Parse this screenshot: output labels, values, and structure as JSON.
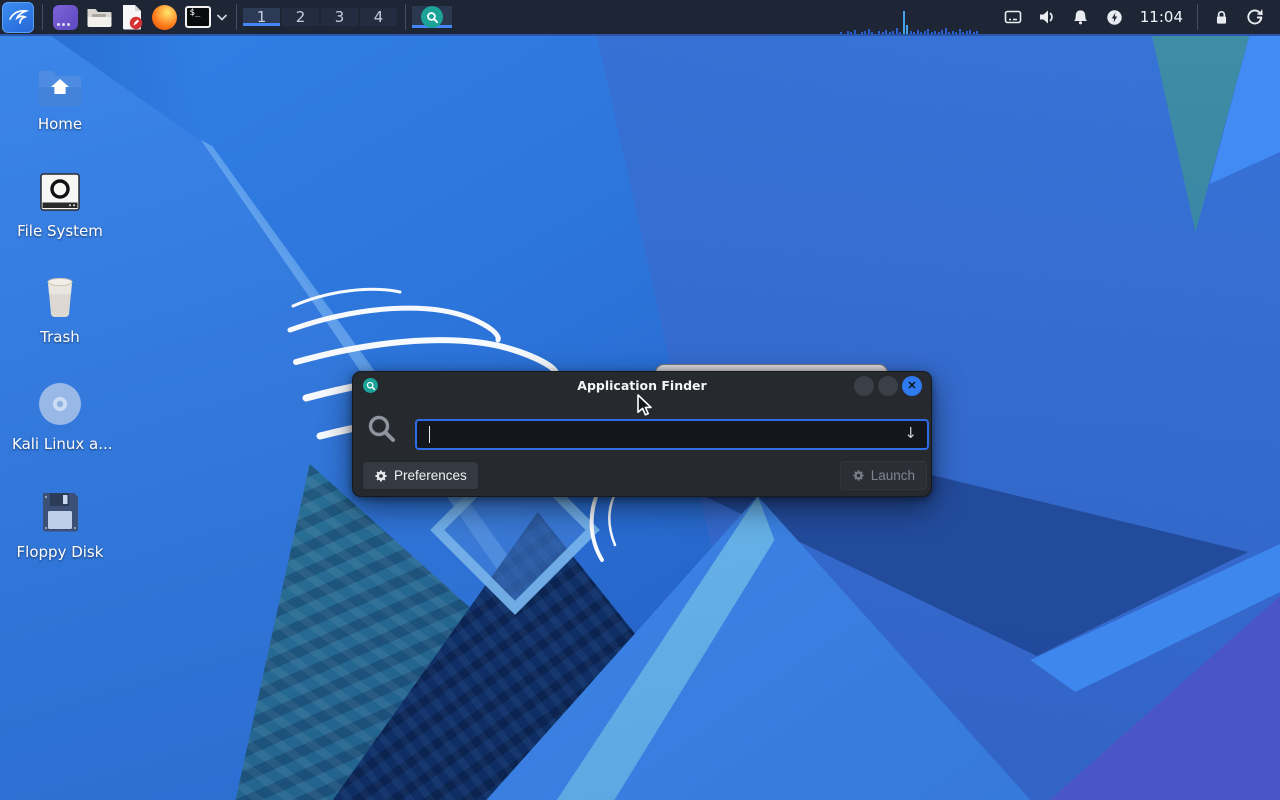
{
  "panel": {
    "clock": "11:04",
    "workspaces": [
      {
        "label": "1"
      },
      {
        "label": "2"
      },
      {
        "label": "3"
      },
      {
        "label": "4"
      }
    ],
    "active_workspace": 0,
    "terminal_prompt": "$_",
    "net_graph_bars": [
      2,
      0,
      3,
      2,
      4,
      0,
      2,
      3,
      5,
      2,
      0,
      3,
      2,
      4,
      2,
      3,
      6,
      2,
      23,
      9,
      3,
      2,
      4,
      2,
      3,
      5,
      2,
      3,
      2,
      4,
      6,
      2,
      3,
      2,
      5,
      2,
      3,
      4,
      2,
      3
    ],
    "colors": {
      "bar_blue": "#2a5fd0",
      "bar_cyan": "#45a3e8"
    }
  },
  "desktop": {
    "icons": [
      {
        "label": "Home"
      },
      {
        "label": "File System"
      },
      {
        "label": "Trash"
      },
      {
        "label": "Kali Linux a..."
      },
      {
        "label": "Floppy Disk"
      }
    ]
  },
  "app_finder": {
    "title": "Application Finder",
    "search_value": "",
    "dropdown_glyph": "↓",
    "preferences_label": "Preferences",
    "launch_label": "Launch"
  },
  "colors": {
    "accent_blue": "#4287f5",
    "teal_icon": "#1aa396",
    "panel_bg": "#1e2635",
    "dialog_bg": "#26292e",
    "close_button": "#2e7bf0"
  }
}
